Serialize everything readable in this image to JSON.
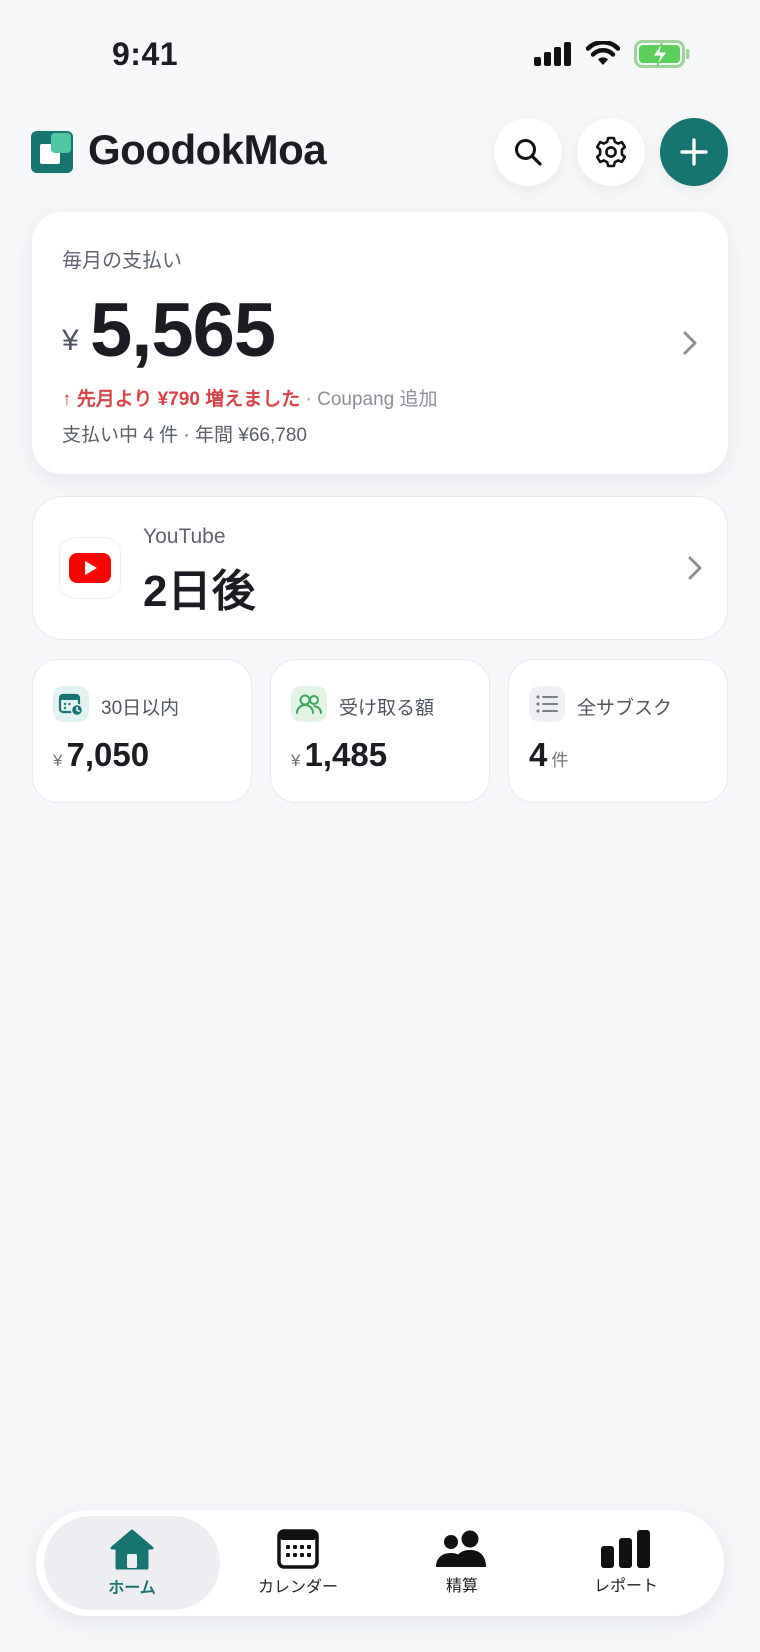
{
  "status_bar": {
    "time": "9:41"
  },
  "app": {
    "title": "GoodokMoa"
  },
  "monthly": {
    "label": "毎月の支払い",
    "currency": "¥",
    "amount": "5,565",
    "change_text": "↑ 先月より ¥790 増えました",
    "change_note": " · Coupang 追加",
    "summary": "支払い中 4 件 · 年間 ¥66,780"
  },
  "next_payment": {
    "service": "YouTube",
    "days": "2日後"
  },
  "stats": [
    {
      "label": "30日以内",
      "currency": "¥",
      "value": "7,050",
      "icon": "calendar-clock-icon"
    },
    {
      "label": "受け取る額",
      "currency": "¥",
      "value": "1,485",
      "icon": "users-icon"
    },
    {
      "label": "全サブスク",
      "value": "4",
      "unit": "件",
      "icon": "list-icon"
    }
  ],
  "tabs": [
    {
      "label": "ホーム",
      "icon": "home-icon",
      "active": true
    },
    {
      "label": "カレンダー",
      "icon": "calendar-icon"
    },
    {
      "label": "精算",
      "icon": "people-icon"
    },
    {
      "label": "レポート",
      "icon": "bar-chart-icon"
    }
  ],
  "colors": {
    "accent": "#177571",
    "increase": "#d8424a",
    "background": "#f5f7f9",
    "youtube": "#ff0000"
  }
}
